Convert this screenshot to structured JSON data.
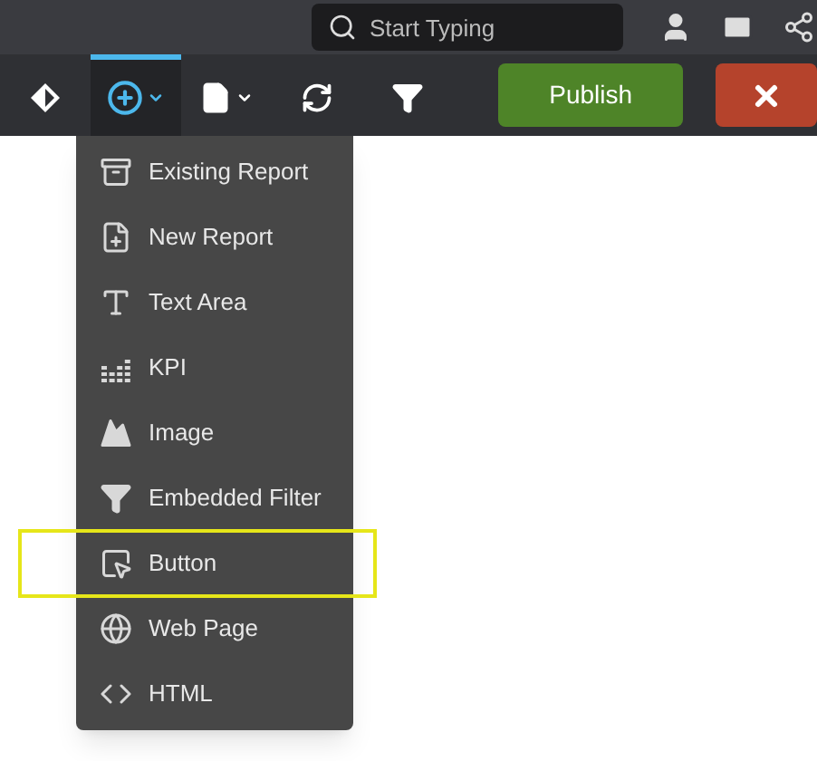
{
  "top_bar": {
    "search": {
      "placeholder": "Start Typing"
    }
  },
  "toolbar": {
    "tools": [
      {
        "selected": false
      },
      {
        "selected": true
      },
      {
        "selected": false
      },
      {
        "selected": false
      },
      {
        "selected": false
      }
    ],
    "publish_button": "Publish"
  },
  "add_menu": {
    "items": [
      {
        "label": "Existing Report",
        "highlighted": false
      },
      {
        "label": "New Report",
        "highlighted": false
      },
      {
        "label": "Text Area",
        "highlighted": false
      },
      {
        "label": "KPI",
        "highlighted": false
      },
      {
        "label": "Image",
        "highlighted": false
      },
      {
        "label": "Embedded Filter",
        "highlighted": false
      },
      {
        "label": "Button",
        "highlighted": true
      },
      {
        "label": "Web Page",
        "highlighted": false
      },
      {
        "label": "HTML",
        "highlighted": false
      }
    ]
  }
}
